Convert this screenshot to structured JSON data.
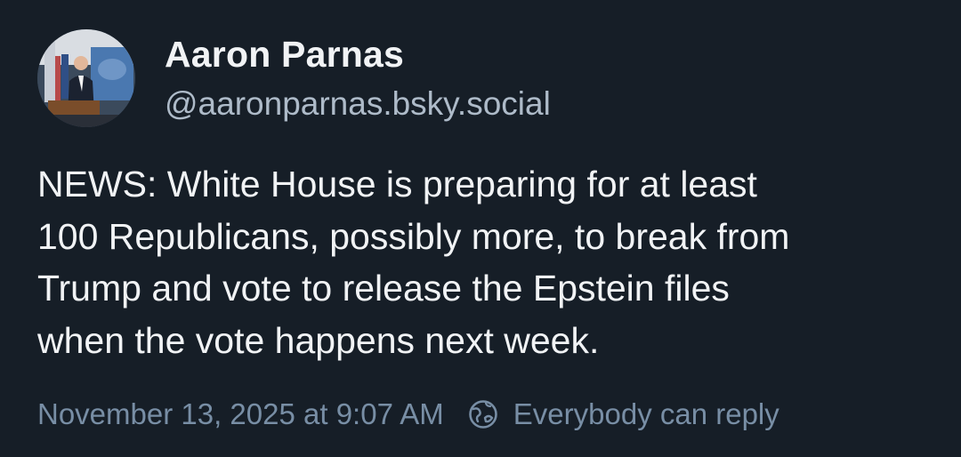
{
  "post": {
    "author": {
      "display_name": "Aaron Parnas",
      "handle": "@aaronparnas.bsky.social",
      "avatar_icon": "profile-photo"
    },
    "text_lines": [
      "NEWS: White House is preparing for at least",
      "100 Republicans, possibly more, to break from",
      "Trump and vote to release the Epstein files",
      "when the vote happens next week."
    ],
    "timestamp": "November 13, 2025 at 9:07 AM",
    "reply_setting": {
      "icon": "globe-icon",
      "label": "Everybody can reply"
    }
  },
  "colors": {
    "background": "#161e27",
    "text_primary": "#f1f3f5",
    "text_handle": "#aebbc9",
    "text_meta": "#788ea5"
  }
}
